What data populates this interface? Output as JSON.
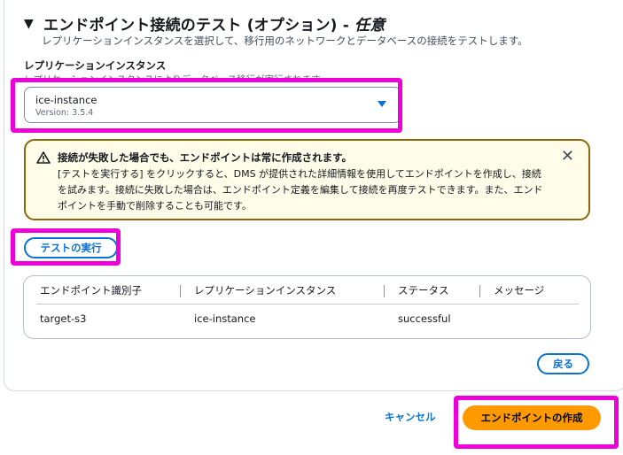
{
  "section": {
    "title": "エンドポイント接続のテスト (オプション) - ",
    "title_optional": "任意",
    "description": "レプリケーションインスタンスを選択して、移行用のネットワークとデータベースの接続をテストします。"
  },
  "replication_instance": {
    "label": "レプリケーションインスタンス",
    "description": "レプリケーションインスタンスによりデータベース移行が実行されます",
    "selected_value": "ice-instance",
    "selected_sub": "Version: 3.5.4"
  },
  "alert": {
    "title": "接続が失敗した場合でも、エンドポイントは常に作成されます。",
    "body": "[テストを実行する] をクリックすると、DMS が提供された詳細情報を使用してエンドポイントを作成し、接続を試みます。接続に失敗した場合は、エンドポイント定義を編集して接続を再度テストできます。また、エンドポイントを手動で削除することも可能です。",
    "close_glyph": "✕"
  },
  "run_test_label": "テストの実行",
  "table": {
    "columns": [
      "エンドポイント識別子",
      "レプリケーションインスタンス",
      "ステータス",
      "メッセージ"
    ],
    "rows": [
      [
        "target-s3",
        "ice-instance",
        "successful",
        ""
      ]
    ]
  },
  "back_label": "戻る",
  "footer": {
    "cancel_label": "キャンセル",
    "create_label": "エンドポイントの作成"
  },
  "colors": {
    "highlight": "#ee00d9",
    "link_blue": "#0972d3",
    "primary_orange": "#ff9900",
    "warning_border": "#8d6605",
    "warning_bg": "#fffce9"
  }
}
